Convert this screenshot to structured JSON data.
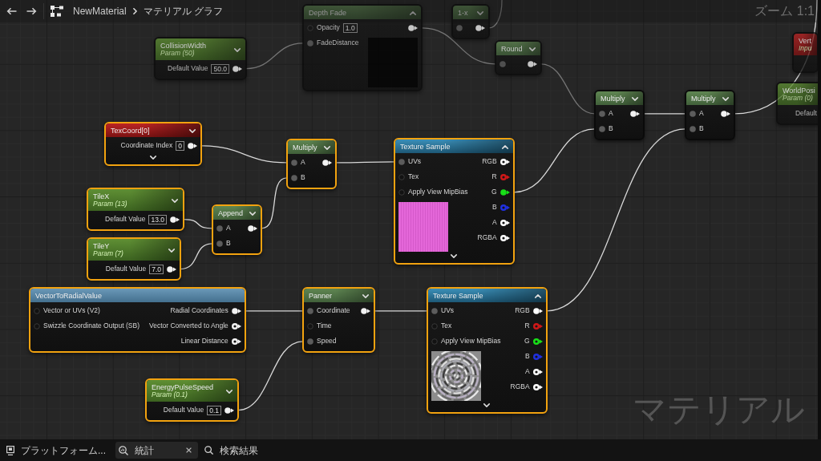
{
  "toolbar": {
    "breadcrumb": [
      {
        "label": "NewMaterial"
      },
      {
        "label": "マテリアル グラフ"
      }
    ],
    "zoom": "ズーム 1:1"
  },
  "nodes": [
    {
      "kind": "operator",
      "title": "Depth Fade",
      "selected": false,
      "dimmed": true,
      "expanded": true,
      "preview": {
        "kind": "empty"
      },
      "inputs": [
        {
          "label": "Opacity",
          "value": "1.0",
          "connected": false
        },
        {
          "label": "FadeDistance",
          "connected": true
        }
      ],
      "outputs": [
        {
          "connected": true
        }
      ]
    },
    {
      "kind": "operator",
      "title": "1-x",
      "selected": false,
      "dimmed": true,
      "expanded": false,
      "inputs": [
        {
          "connected": true
        }
      ],
      "outputs": [
        {
          "connected": true
        }
      ]
    },
    {
      "kind": "parameter",
      "title": "CollisionWidth",
      "subtitle": "Param (50)",
      "selected": false,
      "dimmed": true,
      "expanded": false,
      "outputs": [
        {
          "label": "Default Value",
          "value": "50.0",
          "connected": true
        }
      ]
    },
    {
      "kind": "input",
      "title": "Vert",
      "subtitle": "Inpu",
      "selected": false,
      "dimmed": true
    },
    {
      "kind": "operator",
      "title": "Round",
      "selected": false,
      "dimmed": true,
      "expanded": false,
      "inputs": [
        {
          "connected": true
        }
      ],
      "outputs": [
        {
          "connected": true
        }
      ]
    },
    {
      "kind": "parameter",
      "title": "WorldPosi",
      "subtitle": "Param (0)",
      "selected": false,
      "dimmed": true,
      "outputs": [
        {
          "label": "Default"
        }
      ]
    },
    {
      "kind": "operator",
      "title": "Multiply",
      "selected": false,
      "dimmed": false,
      "expanded": false,
      "inputs": [
        {
          "label": "A",
          "connected": true
        },
        {
          "label": "B",
          "connected": true
        }
      ],
      "outputs": [
        {
          "connected": true
        }
      ]
    },
    {
      "kind": "operator",
      "title": "Multiply",
      "selected": false,
      "dimmed": false,
      "expanded": false,
      "inputs": [
        {
          "label": "A",
          "connected": true
        },
        {
          "label": "B",
          "connected": true
        }
      ],
      "outputs": [
        {
          "connected": true
        }
      ]
    },
    {
      "kind": "input",
      "title": "TexCoord[0]",
      "selected": true,
      "dimmed": false,
      "expanded": false,
      "more_pins": true,
      "outputs": [
        {
          "label": "Coordinate Index",
          "value": "0",
          "connected": true
        }
      ]
    },
    {
      "kind": "operator",
      "title": "Multiply",
      "selected": true,
      "dimmed": false,
      "expanded": false,
      "inputs": [
        {
          "label": "A",
          "connected": true
        },
        {
          "label": "B",
          "connected": true
        }
      ],
      "outputs": [
        {
          "connected": true
        }
      ]
    },
    {
      "kind": "texture",
      "title": "Texture Sample",
      "selected": true,
      "dimmed": false,
      "expanded": true,
      "more_pins": true,
      "preview": {
        "kind": "tile"
      },
      "inputs": [
        {
          "label": "UVs",
          "connected": true
        },
        {
          "label": "Tex",
          "connected": false
        },
        {
          "label": "Apply View MipBias",
          "connected": false
        }
      ],
      "outputs": [
        {
          "label": "RGB",
          "connected": false,
          "color": "#ffffff"
        },
        {
          "label": "R",
          "connected": false,
          "color": "#d01818"
        },
        {
          "label": "G",
          "connected": true,
          "color": "#18e018"
        },
        {
          "label": "B",
          "connected": false,
          "color": "#2030e0"
        },
        {
          "label": "A",
          "connected": false,
          "color": "#ffffff"
        },
        {
          "label": "RGBA",
          "connected": false,
          "color": "#ffffff"
        }
      ]
    },
    {
      "kind": "parameter",
      "title": "TileX",
      "subtitle": "Param (13)",
      "selected": true,
      "dimmed": false,
      "expanded": false,
      "outputs": [
        {
          "label": "Default Value",
          "value": "13.0",
          "connected": true
        }
      ]
    },
    {
      "kind": "operator",
      "title": "Append",
      "selected": true,
      "dimmed": false,
      "expanded": false,
      "inputs": [
        {
          "label": "A",
          "connected": true
        },
        {
          "label": "B",
          "connected": true
        }
      ],
      "outputs": [
        {
          "connected": true
        }
      ]
    },
    {
      "kind": "parameter",
      "title": "TileY",
      "subtitle": "Param (7)",
      "selected": true,
      "dimmed": false,
      "expanded": false,
      "outputs": [
        {
          "label": "Default Value",
          "value": "7.0",
          "connected": true
        }
      ]
    },
    {
      "kind": "function",
      "title": "VectorToRadialValue",
      "selected": true,
      "dimmed": false,
      "inputs": [
        {
          "label": "Vector or UVs (V2)",
          "connected": false
        },
        {
          "label": "Swizzle Coordinate Output (SB)",
          "connected": false
        }
      ],
      "outputs": [
        {
          "label": "Radial Coordinates",
          "connected": true
        },
        {
          "label": "Vector Converted to Angle",
          "connected": false
        },
        {
          "label": "Linear Distance",
          "connected": false
        }
      ]
    },
    {
      "kind": "operator",
      "title": "Panner",
      "selected": true,
      "dimmed": false,
      "expanded": false,
      "inputs": [
        {
          "label": "Coordinate",
          "connected": true
        },
        {
          "label": "Time",
          "connected": false
        },
        {
          "label": "Speed",
          "connected": true
        }
      ],
      "outputs": [
        {
          "connected": true
        }
      ]
    },
    {
      "kind": "texture",
      "title": "Texture Sample",
      "selected": true,
      "dimmed": false,
      "expanded": true,
      "more_pins": true,
      "preview": {
        "kind": "swirl"
      },
      "inputs": [
        {
          "label": "UVs",
          "connected": true
        },
        {
          "label": "Tex",
          "connected": false
        },
        {
          "label": "Apply View MipBias",
          "connected": false
        }
      ],
      "outputs": [
        {
          "label": "RGB",
          "connected": true,
          "color": "#ffffff"
        },
        {
          "label": "R",
          "connected": false,
          "color": "#d01818"
        },
        {
          "label": "G",
          "connected": false,
          "color": "#18e018"
        },
        {
          "label": "B",
          "connected": false,
          "color": "#2030e0"
        },
        {
          "label": "A",
          "connected": false,
          "color": "#ffffff"
        },
        {
          "label": "RGBA",
          "connected": false,
          "color": "#ffffff"
        }
      ]
    },
    {
      "kind": "parameter",
      "title": "EnergyPulseSpeed",
      "subtitle": "Param (0.1)",
      "selected": true,
      "dimmed": false,
      "expanded": false,
      "outputs": [
        {
          "label": "Default Value",
          "value": "0.1",
          "connected": true
        }
      ]
    }
  ],
  "graph_type_label": "マテリアル",
  "bottom_tabs": [
    {
      "label": "プラットフォーム...",
      "selected": false,
      "closable": false
    },
    {
      "label": "統計",
      "selected": true,
      "closable": true
    },
    {
      "label": "検索結果",
      "selected": false,
      "closable": false
    }
  ]
}
